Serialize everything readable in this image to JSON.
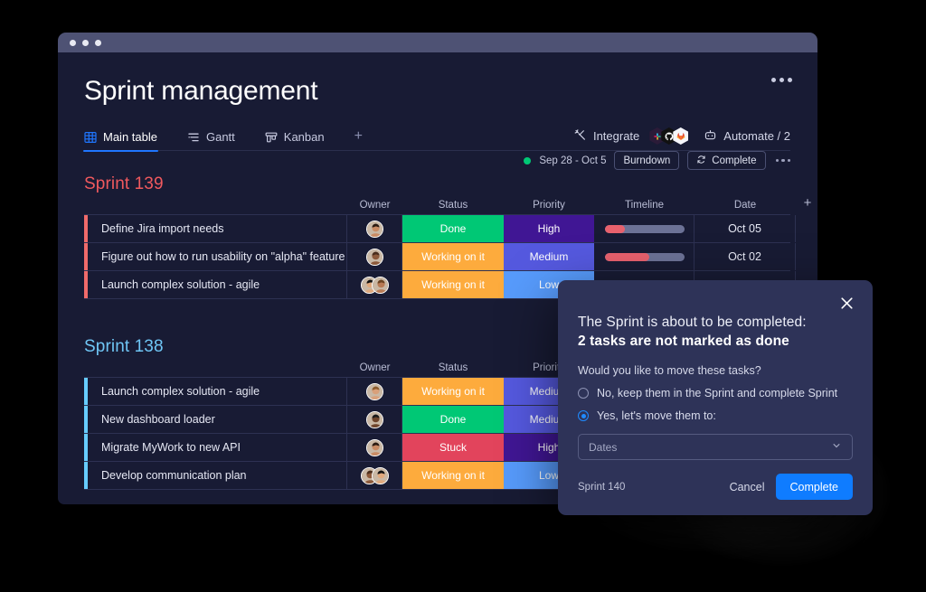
{
  "window": {
    "title": "Sprint management",
    "more_icon": "ellipsis-icon"
  },
  "tabs": [
    {
      "label": "Main table",
      "icon": "table-icon",
      "active": true
    },
    {
      "label": "Gantt",
      "icon": "gantt-icon",
      "active": false
    },
    {
      "label": "Kanban",
      "icon": "kanban-icon",
      "active": false
    }
  ],
  "tab_add_label": "+",
  "toolbar": {
    "integrate_label": "Integrate",
    "integrate_icon": "integrate-icon",
    "integrations": [
      "slack-icon",
      "github-icon",
      "gitlab-icon"
    ],
    "automate_label": "Automate / 2",
    "automate_icon": "robot-icon"
  },
  "columns": {
    "title": "",
    "owner": "Owner",
    "status": "Status",
    "priority": "Priority",
    "timeline": "Timeline",
    "date": "Date",
    "add": "+"
  },
  "sprint_meta": {
    "range": "Sep 28 - Oct 5",
    "burndown_label": "Burndown",
    "complete_label": "Complete",
    "complete_icon": "refresh-icon",
    "more_icon": "ellipsis-icon"
  },
  "groups": [
    {
      "name": "Sprint 139",
      "color": "#F06A6A",
      "rows": [
        {
          "title": "Define Jira import needs",
          "owner": "single",
          "status": "Done",
          "status_color": "#00C875",
          "priority": "High",
          "priority_color": "#401694",
          "timeline_pct": 25,
          "date": "Oct 05"
        },
        {
          "title": "Figure out how to run usability on \"alpha\" feature",
          "owner": "single",
          "status": "Working on it",
          "status_color": "#FDAB3D",
          "priority": "Medium",
          "priority_color": "#5559DF",
          "timeline_pct": 56,
          "date": "Oct 02"
        },
        {
          "title": "Launch complex solution - agile",
          "owner": "pair",
          "status": "Working on it",
          "status_color": "#FDAB3D",
          "priority": "Low",
          "priority_color": "#579BFC",
          "timeline_pct": 0,
          "date": ""
        }
      ]
    },
    {
      "name": "Sprint 138",
      "color": "#66CCFF",
      "rows": [
        {
          "title": "Launch complex solution - agile",
          "owner": "single",
          "status": "Working on it",
          "status_color": "#FDAB3D",
          "priority": "Medium",
          "priority_color": "#5559DF",
          "timeline_pct": 0,
          "date": ""
        },
        {
          "title": "New dashboard loader",
          "owner": "single",
          "status": "Done",
          "status_color": "#00C875",
          "priority": "Medium",
          "priority_color": "#5559DF",
          "timeline_pct": 0,
          "date": ""
        },
        {
          "title": "Migrate MyWork to new API",
          "owner": "single",
          "status": "Stuck",
          "status_color": "#E2445C",
          "priority": "High",
          "priority_color": "#401694",
          "timeline_pct": 0,
          "date": ""
        },
        {
          "title": "Develop communication plan",
          "owner": "pair",
          "status": "Working on it",
          "status_color": "#FDAB3D",
          "priority": "Low",
          "priority_color": "#579BFC",
          "timeline_pct": 0,
          "date": ""
        }
      ]
    }
  ],
  "modal": {
    "close_icon": "close-icon",
    "heading_1": "The Sprint is about to be completed:",
    "heading_2": "2 tasks are not marked as done",
    "question": "Would you like to move these tasks?",
    "options": [
      {
        "label": "No, keep them in the Sprint and complete Sprint",
        "selected": false
      },
      {
        "label": "Yes, let's move them to:",
        "selected": true
      }
    ],
    "select_placeholder": "Dates",
    "select_chevron": "chevron-down-icon",
    "footer_note": "Sprint 140",
    "cancel_label": "Cancel",
    "complete_label": "Complete",
    "accent_color": "#0F7CFF"
  }
}
